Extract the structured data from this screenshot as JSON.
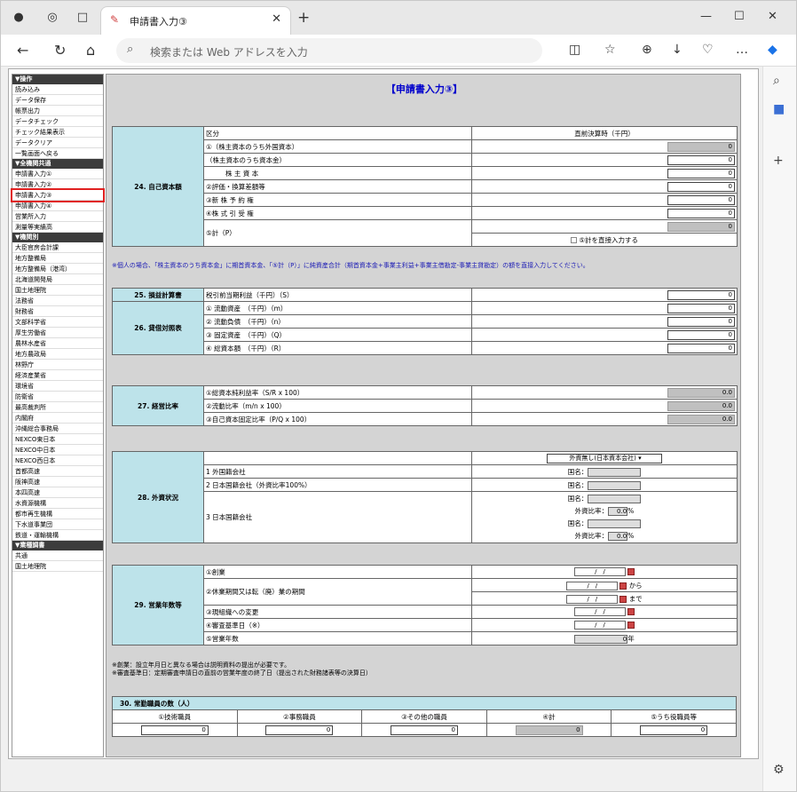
{
  "browser": {
    "tab_title": "申請書入力③",
    "address_placeholder": "検索または Web アドレスを入力"
  },
  "sidebar": {
    "groups": [
      {
        "header": "▼操作",
        "items": [
          "読み込み",
          "データ保存",
          "帳票出力",
          "データチェック",
          "チェック結果表示",
          "データクリア",
          "一覧画面へ戻る"
        ]
      },
      {
        "header": "▼全機関共通",
        "items": [
          "申請書入力①",
          "申請書入力②",
          "申請書入力③",
          "申請書入力④",
          "営業所入力",
          "測量等実績高"
        ]
      },
      {
        "header": "▼機関別",
        "items": [
          "大臣官房会計課",
          "地方整備局",
          "地方整備局（港湾）",
          "北海道開発局",
          "国土地理院",
          "法務省",
          "財務省",
          "文部科学省",
          "厚生労働省",
          "農林水産省",
          "地方農政局",
          "林野庁",
          "経済産業省",
          "環境省",
          "防衛省",
          "最高裁判所",
          "内閣府",
          "沖縄総合事務局",
          "NEXCO東日本",
          "NEXCO中日本",
          "NEXCO西日本",
          "首都高速",
          "阪神高速",
          "本四高速",
          "水資源機構",
          "都市再生機構",
          "下水道事業団",
          "鉄道・運輸機構"
        ]
      },
      {
        "header": "▼業種調書",
        "items": [
          "共通",
          "国土地理院"
        ]
      }
    ]
  },
  "form": {
    "title": "【申請書入力③】",
    "s24": {
      "label": "24. 自己資本額",
      "col_kubun": "区分",
      "col_value": "直前決算時（千円）",
      "row1a": "①（株主資本のうち外国資本）",
      "row1b": "（株主資本のうち資本金）",
      "row1c": "株 主 資 本",
      "row2": "②評価・換算差額等",
      "row3": "③新 株 予 約 権",
      "row4": "④株 式 引 受 権",
      "row5": "⑤計（P）",
      "direct_input": "⑤計を直接入力する",
      "zero": "0"
    },
    "note24": "※個人の場合、「株主資本のうち資本金」に期首資本金、「⑤計（P）」に純資産合計（期首資本金+事業主利益+事業主借勘定-事業主貸勘定）の額を直接入力してください。",
    "s25": {
      "label": "25. 損益計算書",
      "row": "税引前当期利益（千円）（S）",
      "value": "0"
    },
    "s26": {
      "label": "26. 貸借対照表",
      "rows": [
        "① 流動資産　（千円）（m）",
        "② 流動負債　（千円）（n）",
        "③ 固定資産　（千円）（Q）",
        "④ 総資本額　（千円）（R）"
      ],
      "value": "0"
    },
    "s27": {
      "label": "27. 経営比率",
      "rows": [
        "①総資本純利益率（S/R x 100）",
        "②流動比率（m/n x 100）",
        "③自己資本固定比率（P/Q x 100）"
      ],
      "value": "0.0"
    },
    "s28": {
      "label": "28. 外資状況",
      "select": "外資無し(日本資本会社)",
      "row1": "1 外国籍会社",
      "row2": "2 日本国籍会社（外資比率100%）",
      "row3": "3 日本国籍会社",
      "country": "国名：",
      "ratio": "外資比率：",
      "ratio_value": "0.0",
      "percent": "%"
    },
    "s29": {
      "label": "29. 営業年数等",
      "rows": [
        "①創業",
        "②休業期間又は転（廃）業の期間",
        "③現組織への変更",
        "④審査基準日（※）",
        "⑤営業年数"
      ],
      "date": "/　/",
      "from": "から",
      "to": "まで",
      "years_value": "0",
      "year": "年"
    },
    "note29a": "※創業：設立年月日と異なる場合は説明資料の提出が必要です。",
    "note29b": "※審査基準日：定期審査申請日の直前の営業年度の終了日（提出された財務諸表等の決算日）",
    "s30": {
      "label": "30. 常勤職員の数（人）",
      "cols": [
        "①技術職員",
        "②事務職員",
        "③その他の職員",
        "④計",
        "⑤うち役職員等"
      ],
      "value": "0"
    }
  }
}
